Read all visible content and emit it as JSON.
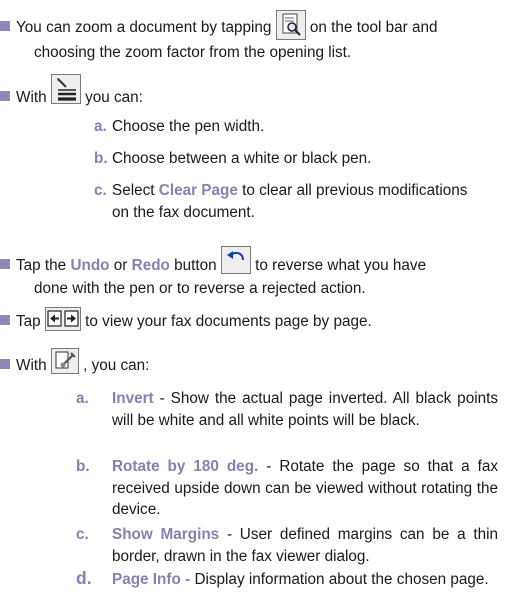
{
  "b1": {
    "part1": "You can zoom a document by tapping",
    "icon": "zoom-page-icon",
    "part2": "on the tool bar and",
    "line2": "choosing the zoom factor from the opening list."
  },
  "b2": {
    "part1": "With",
    "icon": "pen-icon",
    "part2": "you can:",
    "items": [
      {
        "letter": "a.",
        "text": "Choose the pen width."
      },
      {
        "letter": "b.",
        "text": "Choose between a white or black pen."
      },
      {
        "letter": "c.",
        "pre": "Select",
        "hl": "Clear Page",
        "post": "to clear all previous modifications",
        "line2": "on the fax document."
      }
    ]
  },
  "b3": {
    "tap": "Tap the",
    "undo": "Undo",
    "or": "or",
    "redo": "Redo",
    "button": "button",
    "icon": "undo-icon",
    "part2": "to reverse what you have",
    "line2": "done with the pen or to reverse a rejected action."
  },
  "b4": {
    "tap": "Tap",
    "icon1": "previous-page-icon",
    "icon2": "next-page-icon",
    "part2": "to view your fax documents page by page."
  },
  "b5": {
    "part1": "With",
    "icon": "tools-icon",
    "part2": ", you can:",
    "items": [
      {
        "letter": "a.",
        "hl": "Invert",
        "text": "- Show the actual page inverted. All black points will be white and all white points will be black."
      },
      {
        "letter": "b.",
        "hl": "Rotate by 180 deg.",
        "text": "- Rotate the page so that a fax received upside down can be viewed without rotating the device."
      },
      {
        "letter": "c.",
        "hl": "Show Margins",
        "text": "- User defined margins can be a thin border, drawn in the fax viewer dialog."
      },
      {
        "letter": "d.",
        "hl": "Page Info -",
        "text": "Display information about the chosen page."
      }
    ]
  }
}
